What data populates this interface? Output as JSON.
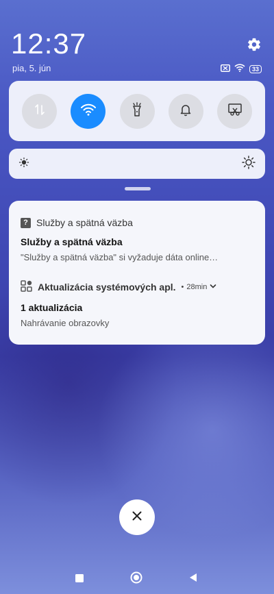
{
  "status": {
    "time": "12:37",
    "date": "pia, 5. jún",
    "battery": "33"
  },
  "quick_settings": [
    {
      "name": "mobile-data",
      "icon": "data-arrows-icon",
      "active": false
    },
    {
      "name": "wifi",
      "icon": "wifi-icon",
      "active": true
    },
    {
      "name": "flashlight",
      "icon": "flashlight-icon",
      "active": false
    },
    {
      "name": "sound",
      "icon": "bell-icon",
      "active": false
    },
    {
      "name": "screenshot",
      "icon": "screenshot-icon",
      "active": false
    }
  ],
  "colors": {
    "accent": "#1a8cff",
    "tile_inactive": "#dcdde3",
    "panel": "#f5f6fb"
  },
  "notifications": [
    {
      "app": "Služby a spätná väzba",
      "title": "Služby a spätná väzba",
      "text": "\"Služby a spätná väzba\" si vyžaduje dáta online…"
    },
    {
      "app": "Aktualizácia systémových apl.",
      "time": "28min",
      "title": "1 aktualizácia",
      "text": "Nahrávanie obrazovky"
    }
  ]
}
